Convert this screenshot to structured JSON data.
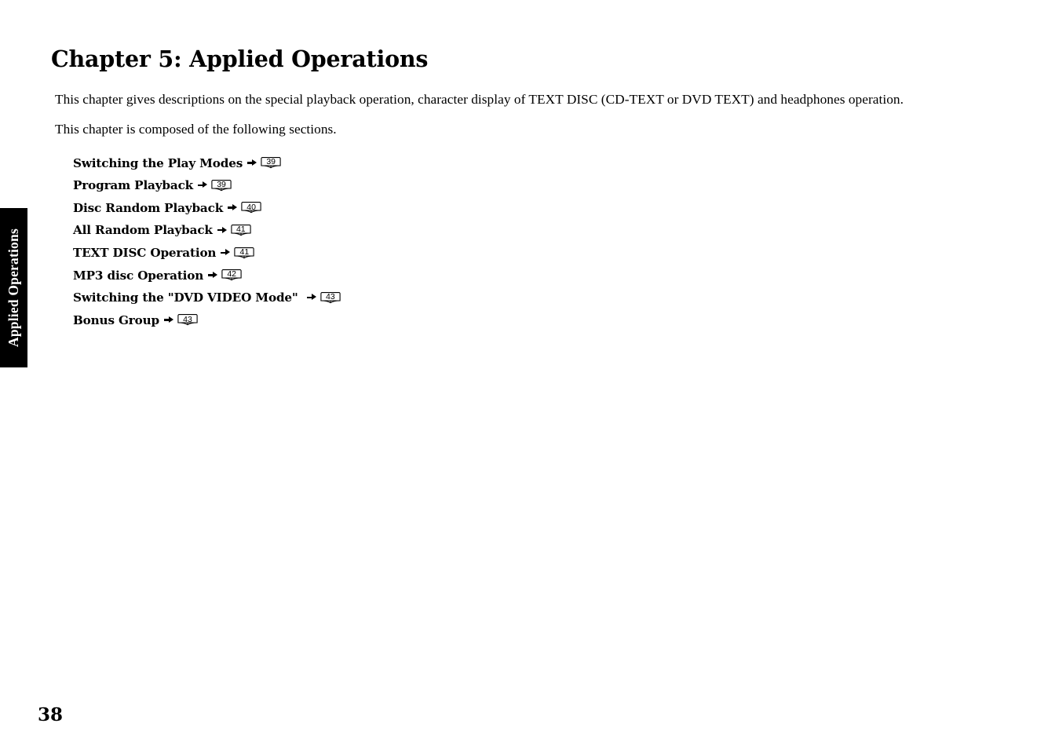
{
  "side_tab": {
    "label": "Applied Operations"
  },
  "title": "Chapter 5: Applied Operations",
  "intro": {
    "line1": "This chapter gives descriptions on the special playback operation, character display of TEXT DISC (CD-TEXT or DVD TEXT) and headphones operation.",
    "line2": "This chapter is composed of the following sections."
  },
  "sections": [
    {
      "label": "Switching the Play Modes",
      "page": "39"
    },
    {
      "label": "Program Playback",
      "page": "39"
    },
    {
      "label": "Disc Random Playback",
      "page": "40"
    },
    {
      "label": "All Random Playback",
      "page": "41"
    },
    {
      "label": "TEXT DISC Operation",
      "page": "41"
    },
    {
      "label": "MP3 disc Operation",
      "page": "42"
    },
    {
      "label": "Switching the \"DVD VIDEO Mode\" ",
      "page": "43"
    },
    {
      "label": "Bonus Group",
      "page": "43"
    }
  ],
  "folio": "38",
  "colors": {
    "tab_background": "#000000",
    "tab_text": "#ffffff",
    "page_background": "#ffffff",
    "body_text": "#000000"
  }
}
